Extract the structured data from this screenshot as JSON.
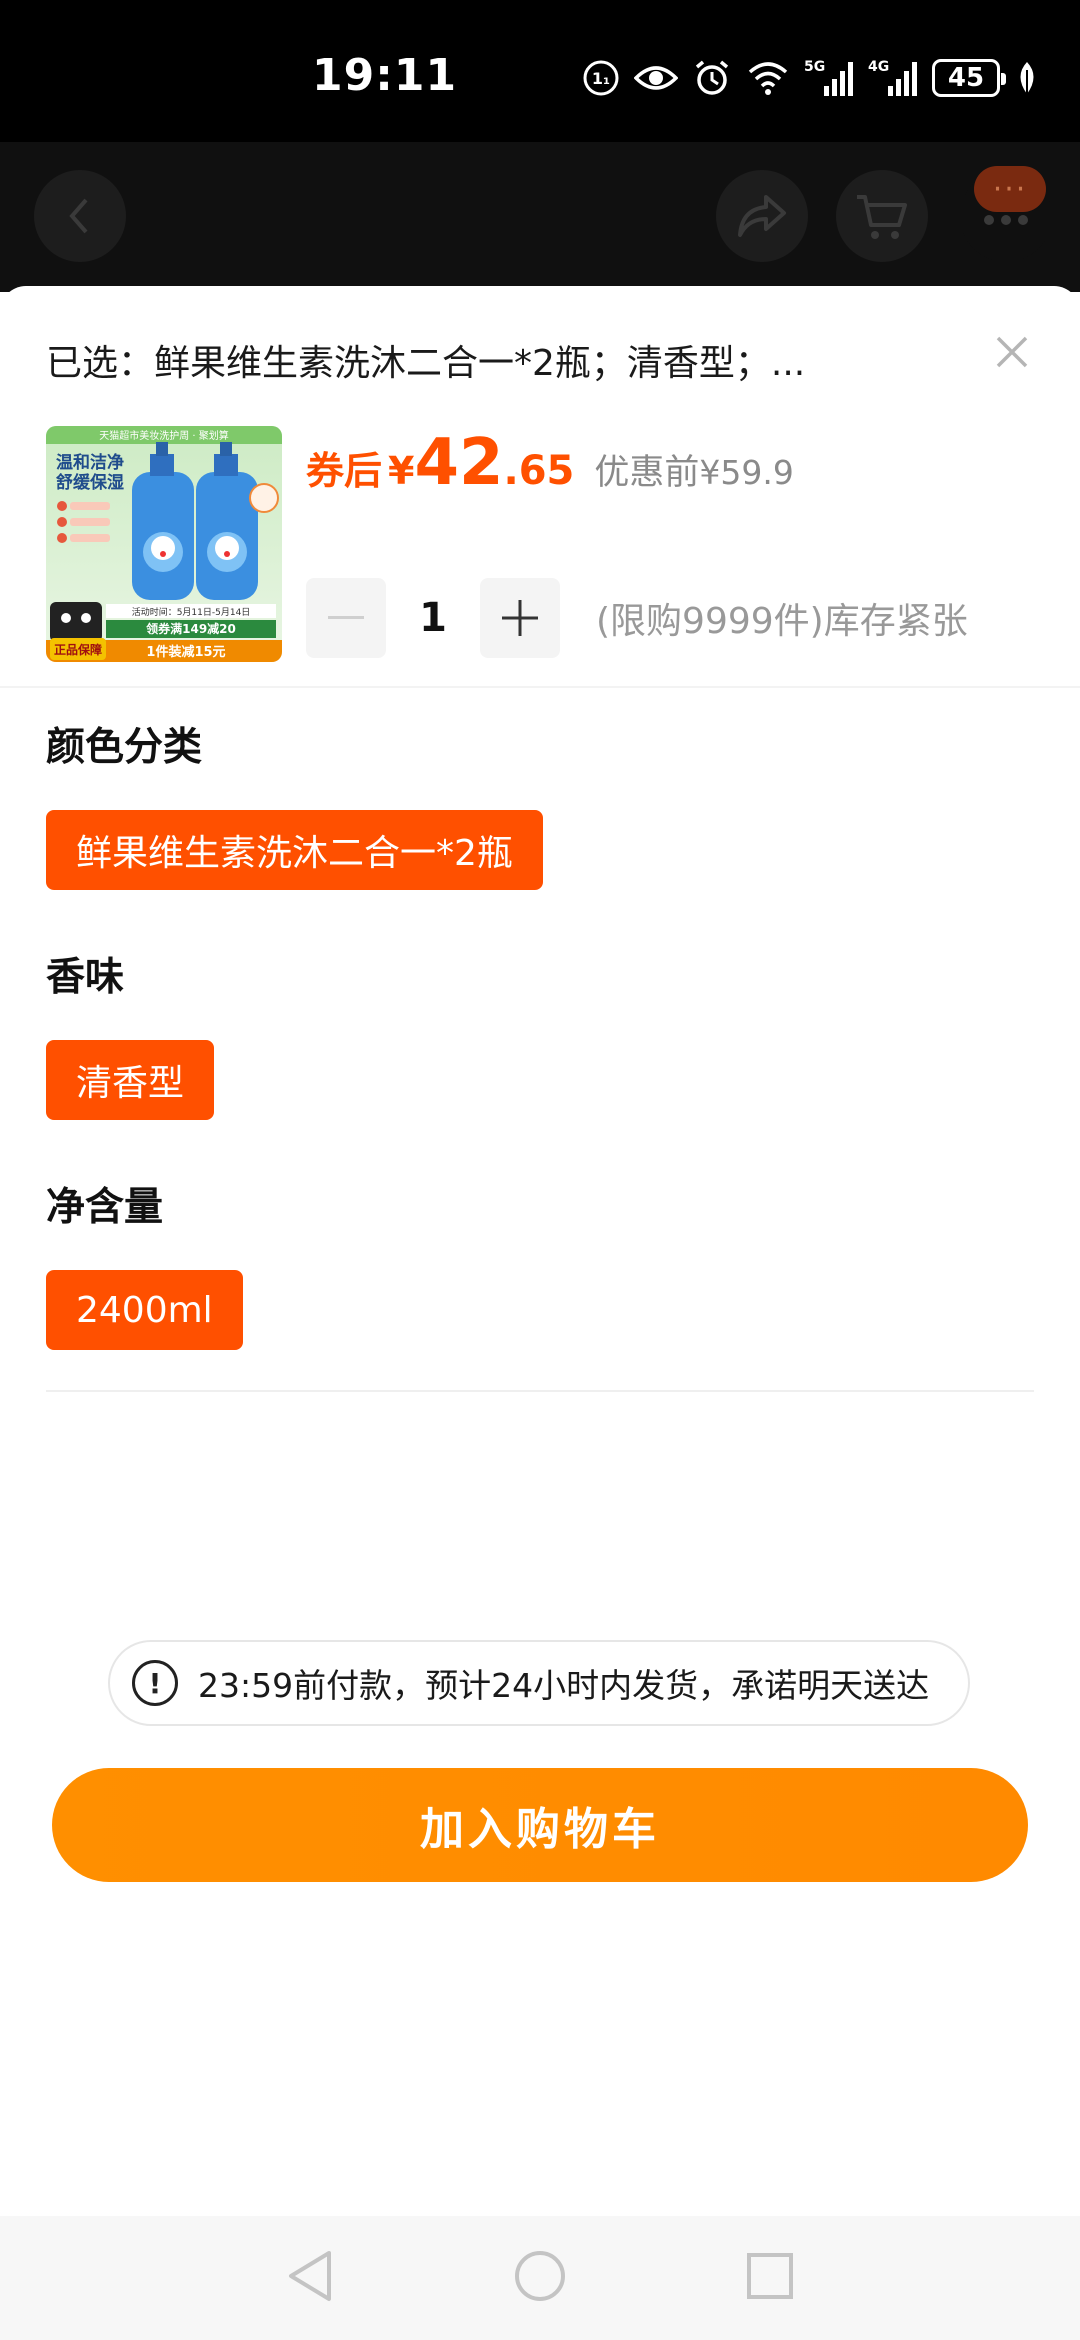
{
  "status_bar": {
    "time": "19:11",
    "network_5g": "5G",
    "network_4g": "4G",
    "battery": "45",
    "icons": [
      "hd-call-icon",
      "eye-icon",
      "alarm-icon",
      "wifi-icon",
      "signal-5g-icon",
      "signal-4g-icon",
      "battery-icon",
      "leaf-icon"
    ]
  },
  "background_header": {
    "icons": [
      "back-icon",
      "share-icon",
      "cart-icon",
      "more-icon"
    ],
    "more_badge": "···"
  },
  "sheet": {
    "selected_text": "已选：鲜果维生素洗沐二合一*2瓶；清香型；...",
    "price": {
      "coupon_label": "券后",
      "currency": "¥",
      "integer": "42",
      "decimal": ".65",
      "original_label": "优惠前",
      "original_price": "¥59.9"
    },
    "quantity": {
      "value": "1",
      "limit_text": "(限购9999件)库存紧张"
    },
    "sections": [
      {
        "title": "颜色分类",
        "option": "鲜果维生素洗沐二合一*2瓶"
      },
      {
        "title": "香味",
        "option": "清香型"
      },
      {
        "title": "净含量",
        "option": "2400ml"
      }
    ],
    "thumbnail": {
      "banner": "天猫超市美妆洗护周 · 聚划算",
      "headline_1": "温和洁净",
      "headline_2": "舒缓保湿",
      "coupon": "领券满149减20",
      "promo": "1件装减15元",
      "guarantee": "正品保障",
      "activity": "活动时间：5月11日-5月14日"
    },
    "notice": "23:59前付款，预计24小时内发货，承诺明天送达",
    "add_to_cart": "加入购物车"
  },
  "colors": {
    "accent": "#ff5000",
    "button": "#ff8c00",
    "muted": "#999999"
  }
}
